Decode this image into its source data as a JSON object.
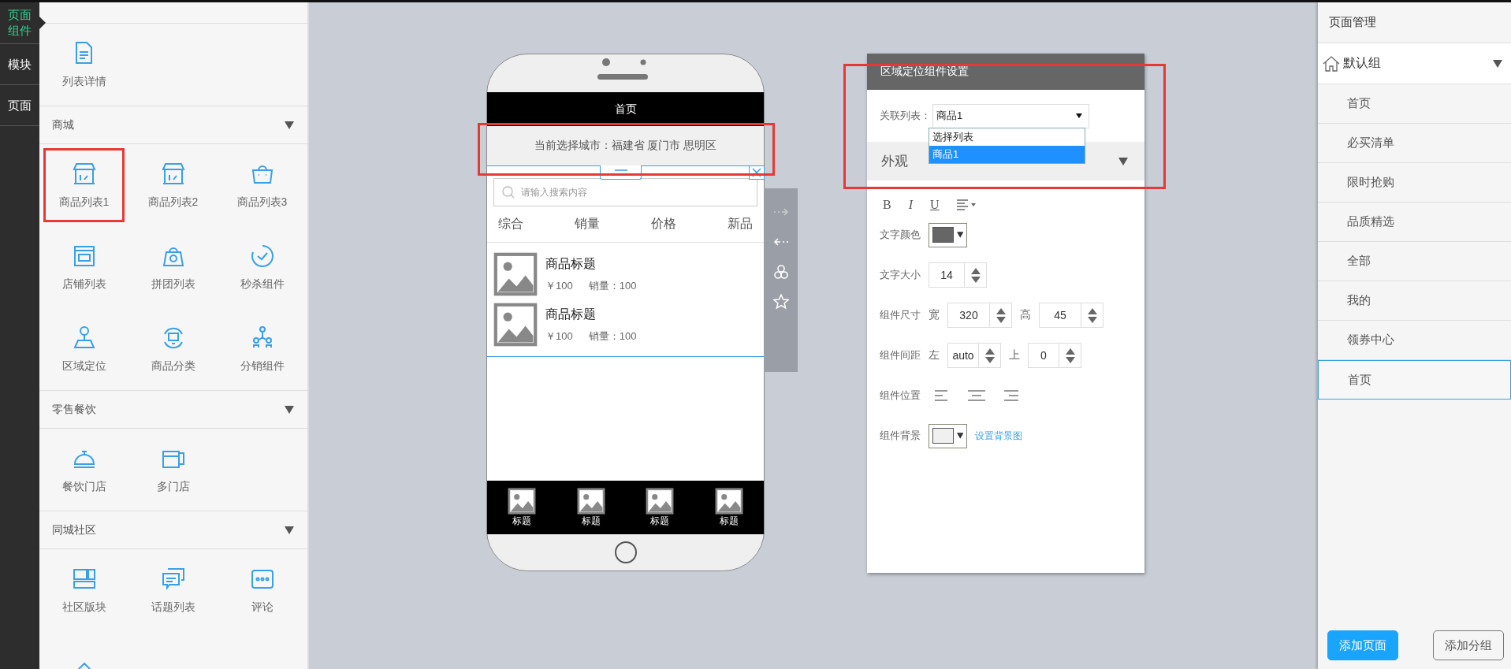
{
  "nav_tabs": [
    {
      "label": "页面组件",
      "selected": true
    },
    {
      "label": "模块",
      "selected": false
    },
    {
      "label": "页面",
      "selected": false
    }
  ],
  "library": {
    "top_items": [
      {
        "label": "列表详情",
        "kind": "document",
        "highlighted": false
      }
    ],
    "sections": [
      {
        "title": "商城",
        "expanded": true,
        "items": [
          {
            "label": "商品列表1",
            "kind": "store",
            "highlighted": true
          },
          {
            "label": "商品列表2",
            "kind": "store",
            "highlighted": false
          },
          {
            "label": "商品列表3",
            "kind": "bag",
            "highlighted": false
          },
          {
            "label": "店铺列表",
            "kind": "shop",
            "highlighted": false
          },
          {
            "label": "拼团列表",
            "kind": "groupbag",
            "highlighted": false
          },
          {
            "label": "秒杀组件",
            "kind": "timer",
            "highlighted": false
          },
          {
            "label": "区域定位",
            "kind": "person",
            "highlighted": false
          },
          {
            "label": "商品分类",
            "kind": "monitor",
            "highlighted": false
          },
          {
            "label": "分销组件",
            "kind": "people",
            "highlighted": false
          }
        ]
      },
      {
        "title": "零售餐饮",
        "expanded": true,
        "items": [
          {
            "label": "餐饮门店",
            "kind": "cloche",
            "highlighted": false
          },
          {
            "label": "多门店",
            "kind": "stores",
            "highlighted": false
          }
        ]
      },
      {
        "title": "同城社区",
        "expanded": true,
        "items": [
          {
            "label": "社区版块",
            "kind": "blocks",
            "highlighted": false
          },
          {
            "label": "话题列表",
            "kind": "chat",
            "highlighted": false
          },
          {
            "label": "评论",
            "kind": "comment",
            "highlighted": false
          },
          {
            "kind": "house",
            "highlighted": false
          }
        ]
      }
    ]
  },
  "phone": {
    "title": "首页",
    "location": {
      "text": "当前选择城市：福建省 厦门市 思明区",
      "highlighted": true
    },
    "search_placeholder": "请输入搜索内容",
    "sort_tabs": [
      "综合",
      "销量",
      "价格",
      "新品"
    ],
    "products": [
      {
        "title": "商品标题",
        "price": "￥100",
        "sales": "销量：100"
      },
      {
        "title": "商品标题",
        "price": "￥100",
        "sales": "销量：100"
      }
    ],
    "tab_bar": [
      {
        "label": "标题"
      },
      {
        "label": "标题"
      },
      {
        "label": "标题"
      },
      {
        "label": "标题"
      }
    ]
  },
  "settings": {
    "title": "区域定位组件设置",
    "highlighted": true,
    "linked_list": {
      "label": "关联列表：",
      "value": "商品1",
      "expanded": true,
      "options": [
        {
          "label": "选择列表",
          "selected": false
        },
        {
          "label": "商品1",
          "selected": true
        }
      ]
    },
    "appearance": {
      "title": "外观",
      "expanded": true
    },
    "format_buttons": [
      {
        "label": "B",
        "kind": "bold"
      },
      {
        "label": "I",
        "kind": "italic"
      },
      {
        "label": "U",
        "kind": "underline"
      }
    ],
    "properties": [
      {
        "kind": "color",
        "label": "文字颜色",
        "color": "#666666"
      },
      {
        "kind": "number",
        "label": "文字大小",
        "value": "14"
      },
      {
        "kind": "pair",
        "label": "组件尺寸",
        "fields": [
          {
            "label": "宽",
            "value": "320"
          },
          {
            "label": "高",
            "value": "45"
          }
        ]
      },
      {
        "kind": "pair",
        "label": "组件间距",
        "fields": [
          {
            "label": "左",
            "value": "auto"
          },
          {
            "label": "上",
            "value": "0"
          }
        ]
      },
      {
        "kind": "align",
        "label": "组件位置"
      },
      {
        "kind": "color",
        "label": "组件背景",
        "color": "#f0f0f0",
        "link": "设置背景图"
      }
    ]
  },
  "page_manager": {
    "title": "页面管理",
    "group": {
      "label": "默认组",
      "expanded": true
    },
    "pages": [
      {
        "label": "首页",
        "selected": false
      },
      {
        "label": "必买清单",
        "selected": false
      },
      {
        "label": "限时抢购",
        "selected": false
      },
      {
        "label": "品质精选",
        "selected": false
      },
      {
        "label": "全部",
        "selected": false
      },
      {
        "label": "我的",
        "selected": false
      },
      {
        "label": "领券中心",
        "selected": false
      },
      {
        "label": "首页",
        "selected": true
      }
    ],
    "buttons": [
      {
        "label": "添加页面",
        "kind": "primary"
      },
      {
        "label": "添加分组",
        "kind": "secondary"
      }
    ]
  }
}
